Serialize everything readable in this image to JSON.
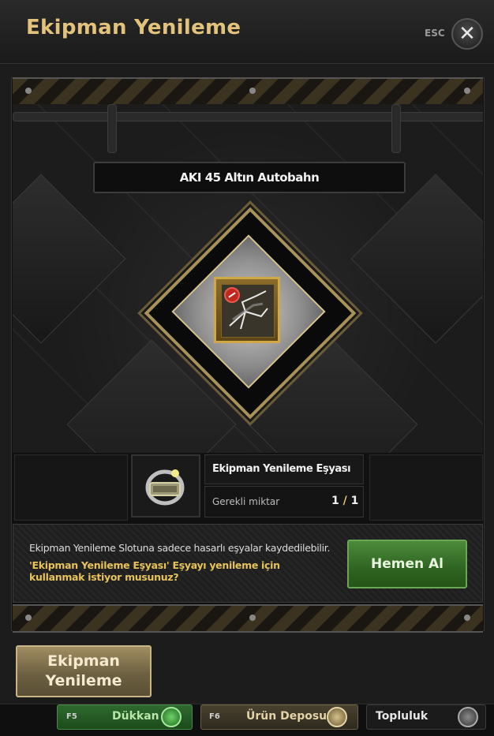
{
  "window": {
    "title": "Ekipman Yenileme",
    "esc_label": "ESC",
    "close_glyph": "✕"
  },
  "item": {
    "name": "AKI 45 Altın Autobahn",
    "icon": "cracked-weapon-icon",
    "status_icon": "prohibited-icon"
  },
  "material": {
    "name": "Ekipman Yenileme Eşyası",
    "required_label": "Gerekli miktar",
    "owned": "1",
    "separator": " / ",
    "required": "1",
    "icon": "repair-kit-icon"
  },
  "message": {
    "line1": "Ekipman Yenileme Slotuna sadece hasarlı eşyalar kaydedilebilir.",
    "line2": "'Ekipman Yenileme Eşyası' Eşyayı yenileme için kullanmak istiyor musunuz?"
  },
  "buttons": {
    "buy_now": "Hemen Al",
    "renew": "Ekipman Yenileme"
  },
  "bottom_bar": {
    "tabs": [
      {
        "key": "F5",
        "label": "Dükkan",
        "icon": "shop-icon"
      },
      {
        "key": "F6",
        "label": "Ürün Deposu",
        "icon": "storage-icon"
      },
      {
        "key": "",
        "label": "Topluluk",
        "icon": "community-icon"
      }
    ]
  },
  "colors": {
    "accent_gold": "#e3c27b",
    "buy_green": "#2f6422",
    "warning_yellow": "#e8c35a",
    "frame_gold": "#a8925a"
  }
}
